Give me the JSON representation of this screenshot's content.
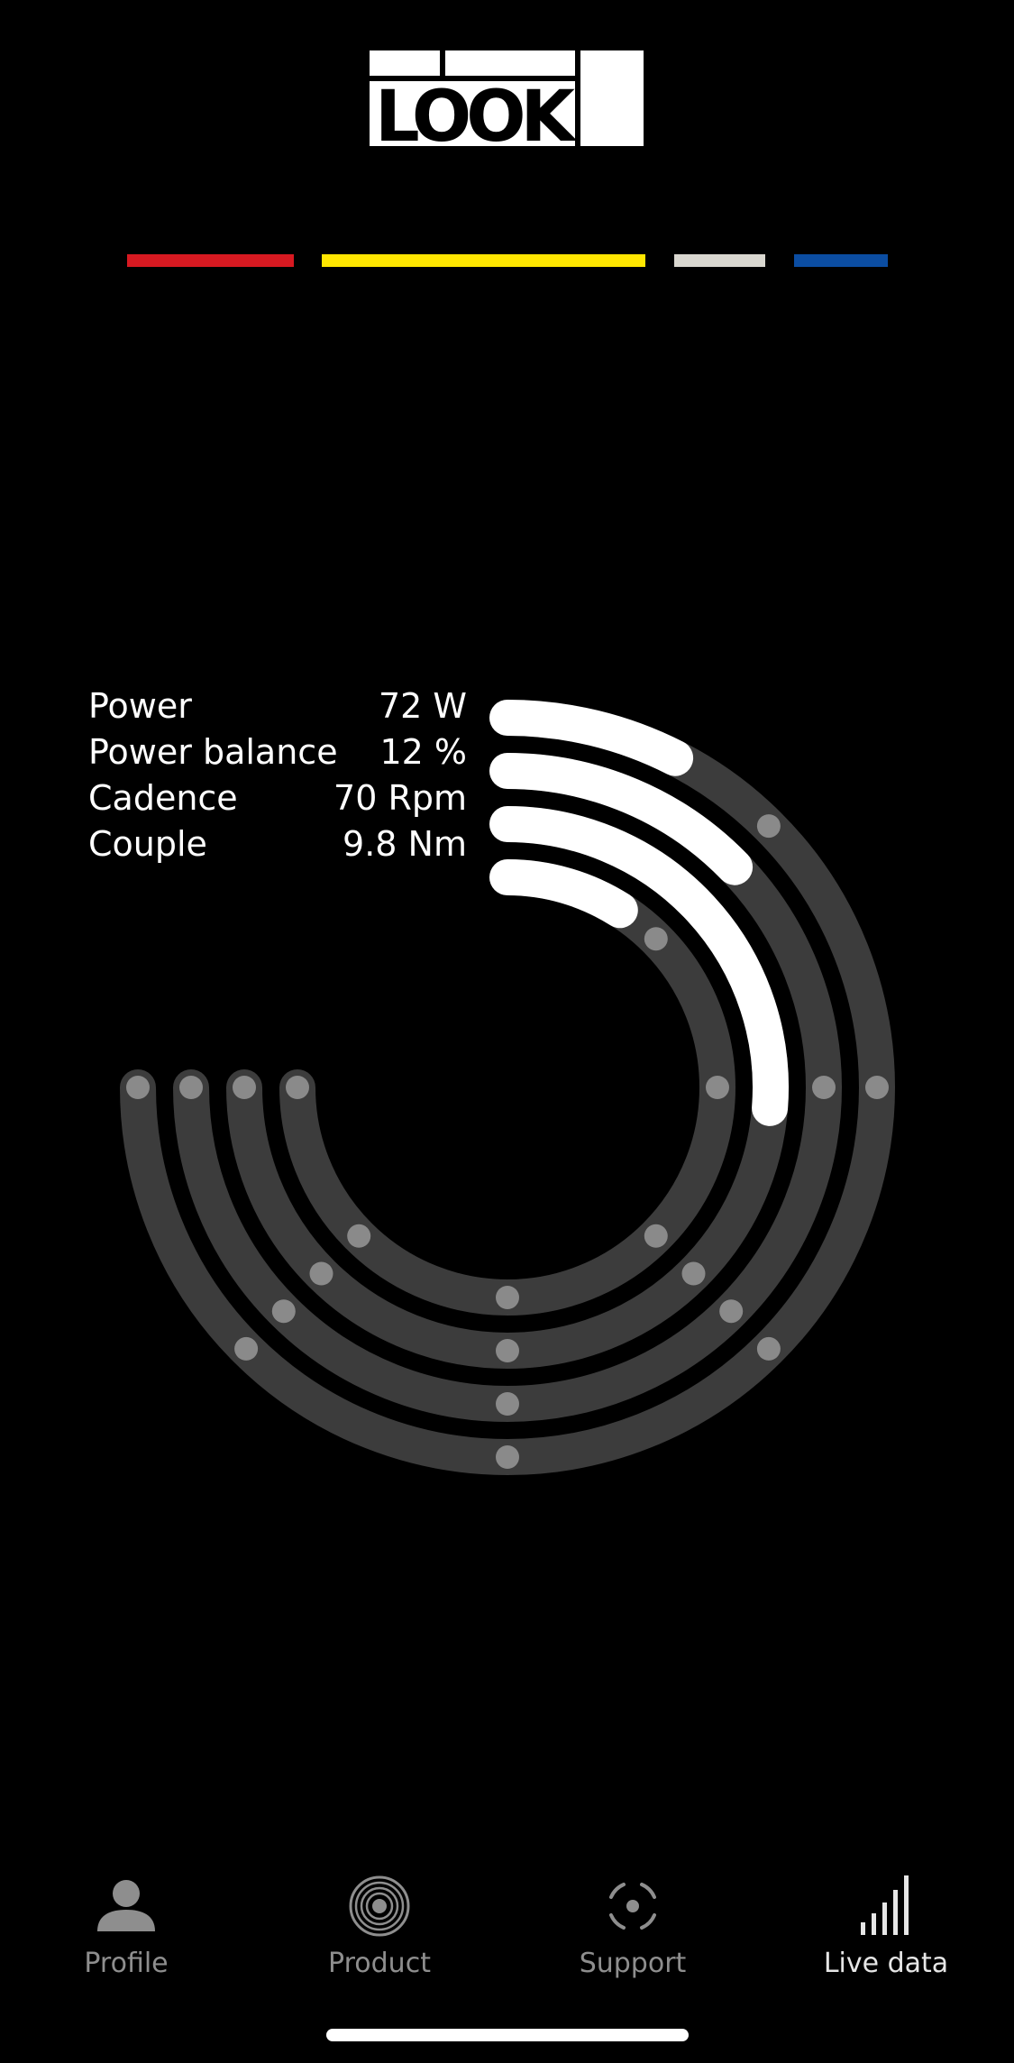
{
  "brand": {
    "name": "LOOK"
  },
  "color_bars": [
    {
      "name": "red",
      "color": "#d71921"
    },
    {
      "name": "yellow",
      "color": "#ffe600"
    },
    {
      "name": "white",
      "color": "#d9d7d0"
    },
    {
      "name": "blue",
      "color": "#0b4da2"
    }
  ],
  "metrics": [
    {
      "label": "Power",
      "value": "72 W",
      "fraction": 0.1
    },
    {
      "label": "Power balance",
      "value": "12 %",
      "fraction": 0.17
    },
    {
      "label": "Cadence",
      "value": "70 Rpm",
      "fraction": 0.35
    },
    {
      "label": "Couple",
      "value": "9.8 Nm",
      "fraction": 0.12
    }
  ],
  "colors": {
    "background": "#000000",
    "track": "#3c3c3c",
    "tick": "#8a8a8a",
    "progress": "#ffffff",
    "tab_inactive": "#8e8e8e",
    "tab_active": "#e6e6e6"
  },
  "tabs": [
    {
      "label": "Profile",
      "icon": "person-icon",
      "active": false
    },
    {
      "label": "Product",
      "icon": "disc-icon",
      "active": false
    },
    {
      "label": "Support",
      "icon": "target-icon",
      "active": false
    },
    {
      "label": "Live data",
      "icon": "signal-bars-icon",
      "active": true
    }
  ]
}
